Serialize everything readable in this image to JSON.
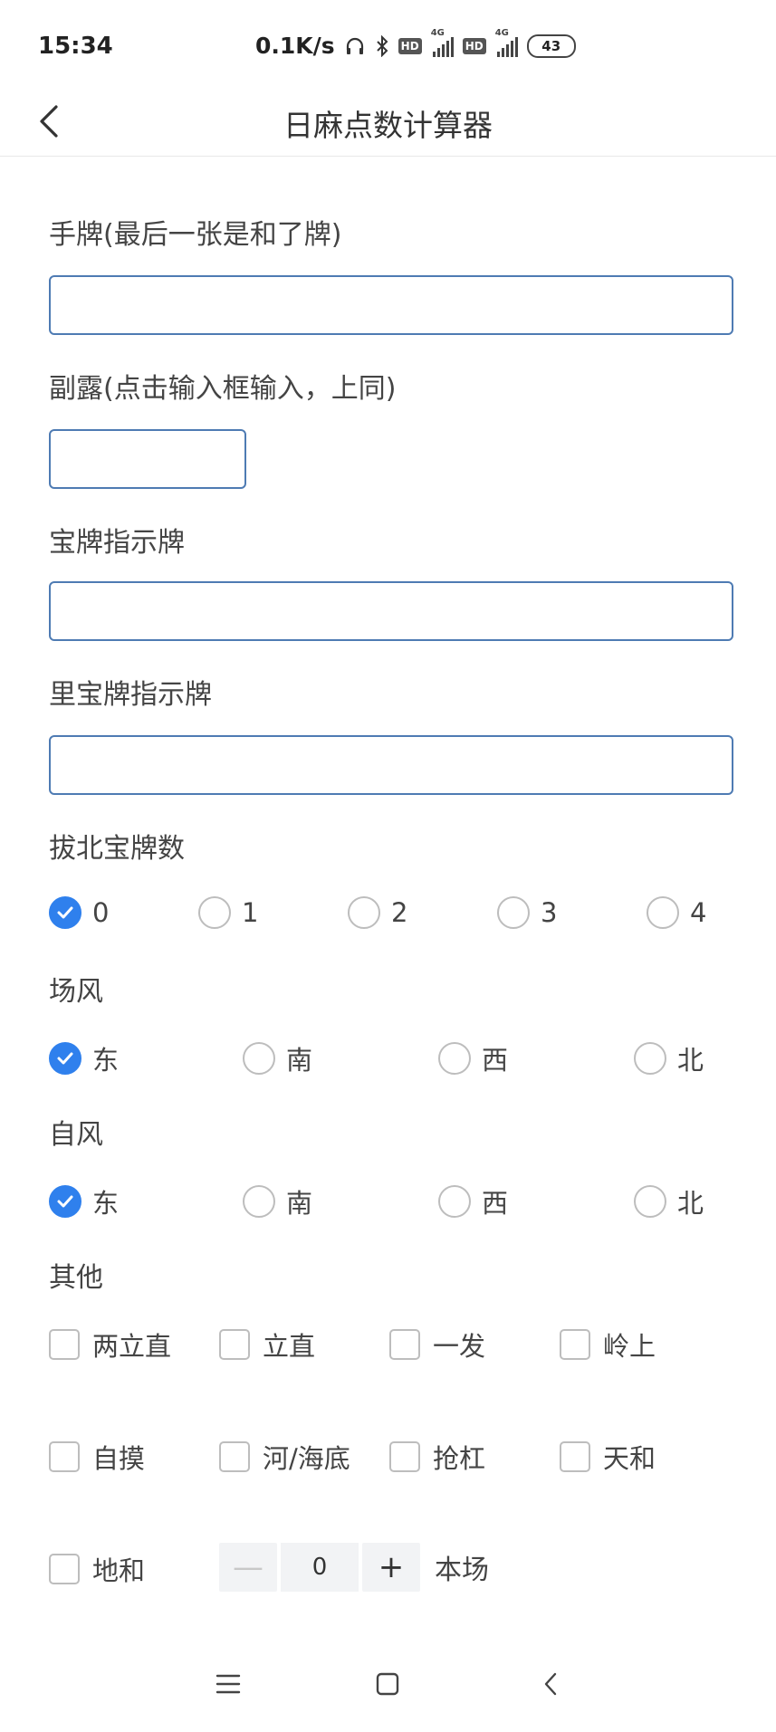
{
  "status_bar": {
    "time": "15:34",
    "net_speed": "0.1K/s",
    "hd1": "HD",
    "hd2": "HD",
    "sig1": "4G",
    "sig2": "4G",
    "battery": "43"
  },
  "header": {
    "title": "日麻点数计算器"
  },
  "fields": {
    "hand": {
      "label": "手牌(最后一张是和了牌)",
      "value": "",
      "placeholder": ""
    },
    "meld": {
      "label": "副露(点击输入框输入，上同)",
      "value": "",
      "placeholder": ""
    },
    "dora": {
      "label": "宝牌指示牌",
      "value": "",
      "placeholder": ""
    },
    "ura_dora": {
      "label": "里宝牌指示牌",
      "value": "",
      "placeholder": ""
    }
  },
  "kita": {
    "label": "拔北宝牌数",
    "options": [
      "0",
      "1",
      "2",
      "3",
      "4"
    ],
    "selected": "0"
  },
  "round_wind": {
    "label": "场风",
    "options": [
      "东",
      "南",
      "西",
      "北"
    ],
    "selected": "东"
  },
  "seat_wind": {
    "label": "自风",
    "options": [
      "东",
      "南",
      "西",
      "北"
    ],
    "selected": "东"
  },
  "others": {
    "label": "其他",
    "options": [
      "两立直",
      "立直",
      "一发",
      "岭上",
      "自摸",
      "河/海底",
      "抢杠",
      "天和",
      "地和"
    ]
  },
  "honba": {
    "minus": "—",
    "value": "0",
    "plus": "+",
    "suffix": "本场"
  },
  "colors": {
    "accent": "#2f80ed",
    "input_border": "#4e7bb3"
  }
}
